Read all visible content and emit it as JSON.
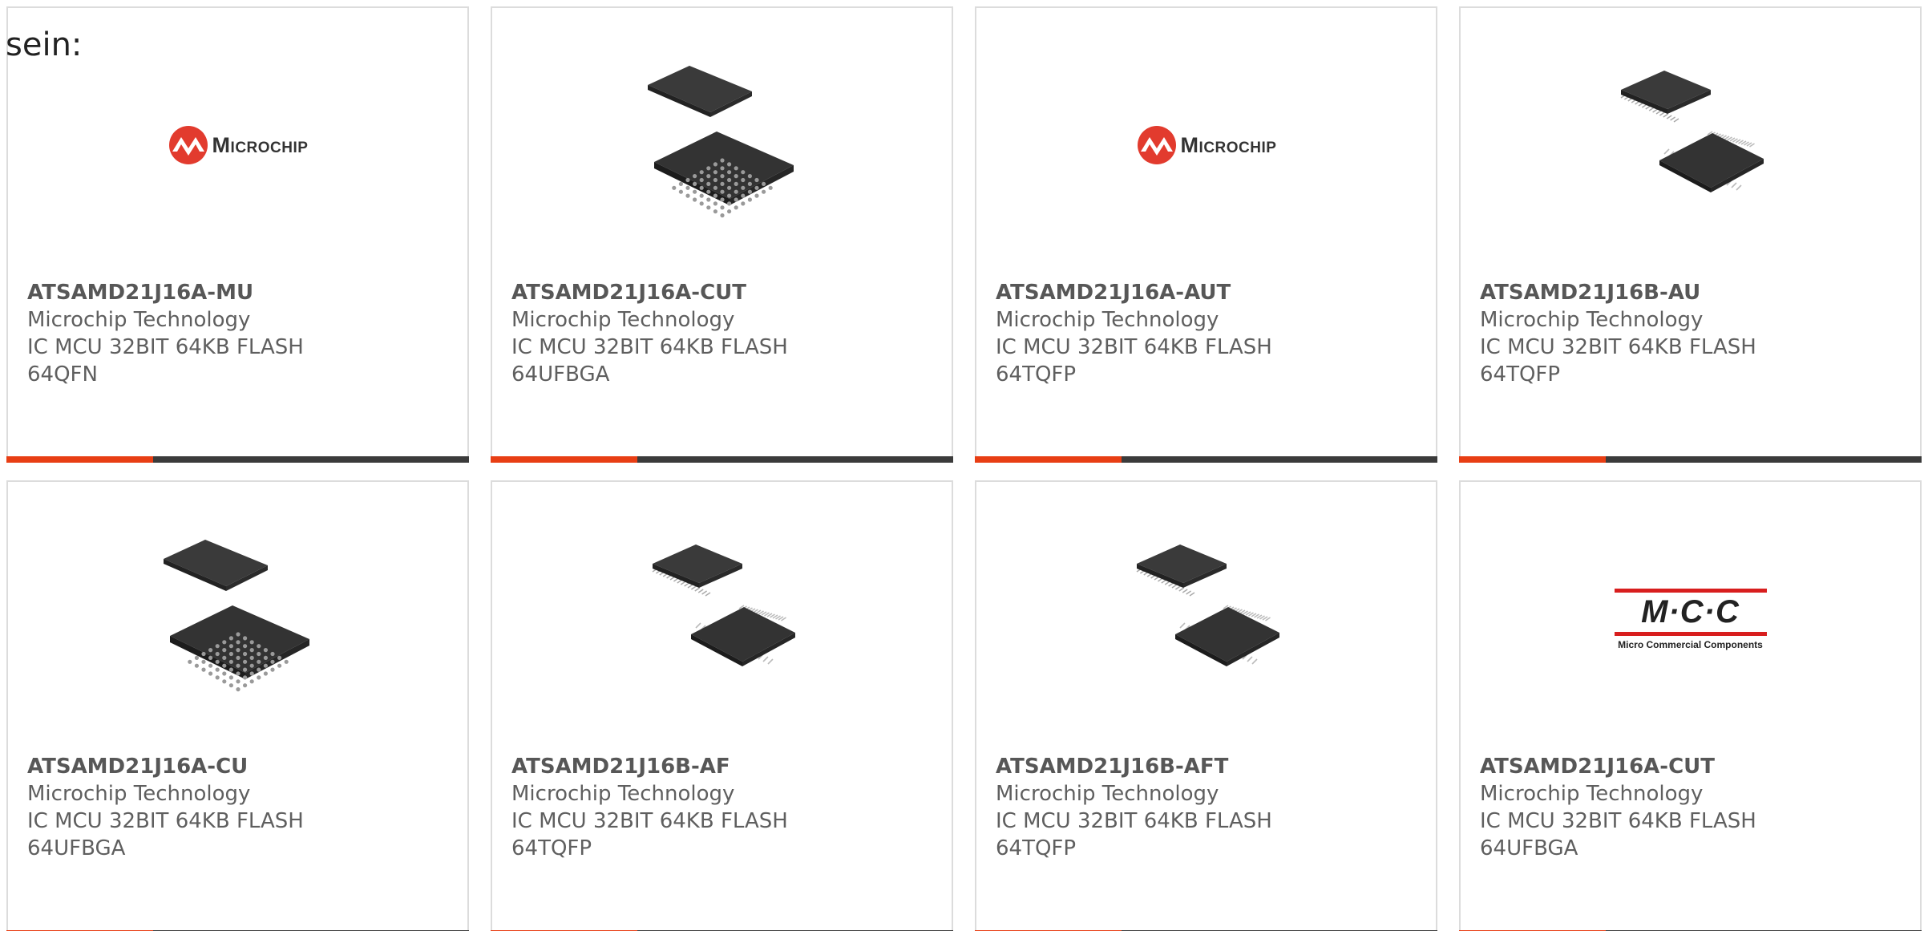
{
  "leading_text": "sein:",
  "cards": [
    {
      "part_number": "ATSAMD21J16A-MU",
      "manufacturer": "Microchip Technology",
      "description": "IC MCU 32BIT 64KB FLASH 64QFN",
      "image": "microchip-logo"
    },
    {
      "part_number": "ATSAMD21J16A-CUT",
      "manufacturer": "Microchip Technology",
      "description": "IC MCU 32BIT 64KB FLASH 64UFBGA",
      "image": "bga-chip-icon"
    },
    {
      "part_number": "ATSAMD21J16A-AUT",
      "manufacturer": "Microchip Technology",
      "description": "IC MCU 32BIT 64KB FLASH 64TQFP",
      "image": "microchip-logo"
    },
    {
      "part_number": "ATSAMD21J16B-AU",
      "manufacturer": "Microchip Technology",
      "description": "IC MCU 32BIT 64KB FLASH 64TQFP",
      "image": "tqfp-chip-icon"
    },
    {
      "part_number": "ATSAMD21J16A-CU",
      "manufacturer": "Microchip Technology",
      "description": "IC MCU 32BIT 64KB FLASH 64UFBGA",
      "image": "bga-chip-icon"
    },
    {
      "part_number": "ATSAMD21J16B-AF",
      "manufacturer": "Microchip Technology",
      "description": "IC MCU 32BIT 64KB FLASH 64TQFP",
      "image": "tqfp-chip-icon"
    },
    {
      "part_number": "ATSAMD21J16B-AFT",
      "manufacturer": "Microchip Technology",
      "description": "IC MCU 32BIT 64KB FLASH 64TQFP",
      "image": "tqfp-chip-icon"
    },
    {
      "part_number": "ATSAMD21J16A-CUT",
      "manufacturer": "Microchip Technology",
      "description": "IC MCU 32BIT 64KB FLASH 64UFBGA",
      "image": "mcc-logo"
    }
  ],
  "logos": {
    "microchip_word": "Microchip",
    "mcc_letters": "M·C·C",
    "mcc_sub": "Micro Commercial Components"
  },
  "colors": {
    "accent": "#e83e14",
    "bar": "#3b3b3b",
    "microchip_red": "#e23b2e",
    "mcc_red": "#d81e1e",
    "text": "#5f5f5f"
  }
}
